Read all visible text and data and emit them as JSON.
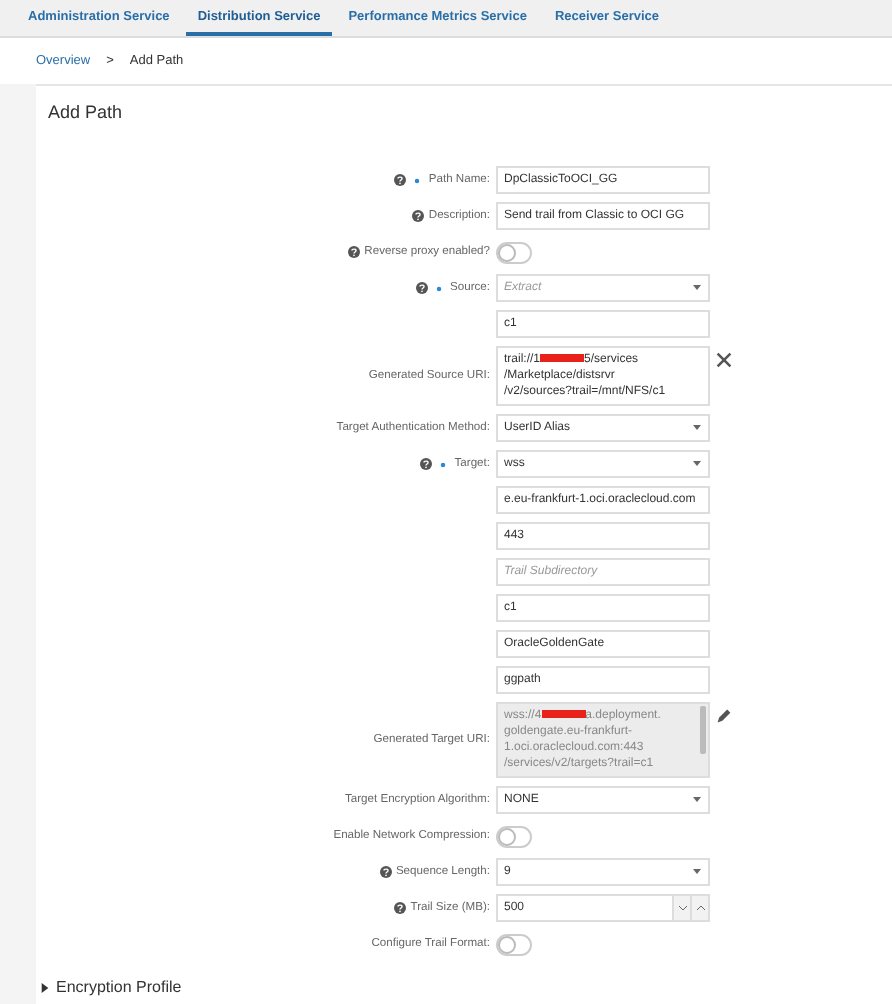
{
  "tabs": [
    {
      "label": "Administration Service",
      "selected": false
    },
    {
      "label": "Distribution Service",
      "selected": true
    },
    {
      "label": "Performance Metrics Service",
      "selected": false
    },
    {
      "label": "Receiver Service",
      "selected": false
    }
  ],
  "breadcrumb": {
    "link": "Overview",
    "separator": ">",
    "current": "Add Path"
  },
  "form": {
    "title": "Add Path",
    "rows": [
      {
        "kind": "text",
        "label": "Path Name:",
        "help": true,
        "required": true,
        "value": "DpClassicToOCI_GG"
      },
      {
        "kind": "text",
        "label": "Description:",
        "help": true,
        "value": "Send trail from Classic to OCI GG"
      },
      {
        "kind": "toggle",
        "label": "Reverse proxy enabled?",
        "help": true,
        "on": false
      },
      {
        "kind": "select",
        "label": "Source:",
        "help": true,
        "required": true,
        "placeholder": "Extract"
      },
      {
        "kind": "text",
        "value": "c1"
      },
      {
        "kind": "uri",
        "label": "Generated Source URI:",
        "disabled": false,
        "clearable": true,
        "lines": [
          {
            "parts": [
              {
                "text": "trail://1"
              },
              {
                "redacted": true
              },
              {
                "text": "5/services"
              }
            ]
          },
          {
            "parts": [
              {
                "text": "/Marketplace/distsrvr"
              }
            ]
          },
          {
            "parts": [
              {
                "text": "/v2/sources?trail=/mnt/NFS/c1"
              }
            ]
          }
        ]
      },
      {
        "kind": "select",
        "label": "Target Authentication Method:",
        "value": "UserID Alias"
      },
      {
        "kind": "select",
        "label": "Target:",
        "help": true,
        "required": true,
        "value": "wss"
      },
      {
        "kind": "text",
        "value": "e.eu-frankfurt-1.oci.oraclecloud.com"
      },
      {
        "kind": "text",
        "value": "443"
      },
      {
        "kind": "text",
        "placeholder": "Trail Subdirectory"
      },
      {
        "kind": "text",
        "value": "c1"
      },
      {
        "kind": "text",
        "value": "OracleGoldenGate"
      },
      {
        "kind": "text",
        "value": "ggpath"
      },
      {
        "kind": "uri",
        "label": "Generated Target URI:",
        "disabled": true,
        "editable": true,
        "lines": [
          {
            "parts": [
              {
                "text": "wss://4"
              },
              {
                "redacted": true
              },
              {
                "text": "a.deployment."
              }
            ]
          },
          {
            "parts": [
              {
                "text": "goldengate.eu-frankfurt-"
              }
            ]
          },
          {
            "parts": [
              {
                "text": "1.oci.oraclecloud.com:443"
              }
            ]
          },
          {
            "parts": [
              {
                "text": "/services/v2/targets?trail=c1"
              }
            ]
          }
        ]
      },
      {
        "kind": "select",
        "label": "Target Encryption Algorithm:",
        "value": "NONE"
      },
      {
        "kind": "toggle",
        "label": "Enable Network Compression:",
        "on": false
      },
      {
        "kind": "select",
        "label": "Sequence Length:",
        "help": true,
        "value": "9"
      },
      {
        "kind": "number",
        "label": "Trail Size (MB):",
        "help": true,
        "value": "500"
      },
      {
        "kind": "toggle",
        "label": "Configure Trail Format:",
        "on": false
      }
    ]
  },
  "section": {
    "label": "Encryption Profile",
    "expanded": false
  }
}
